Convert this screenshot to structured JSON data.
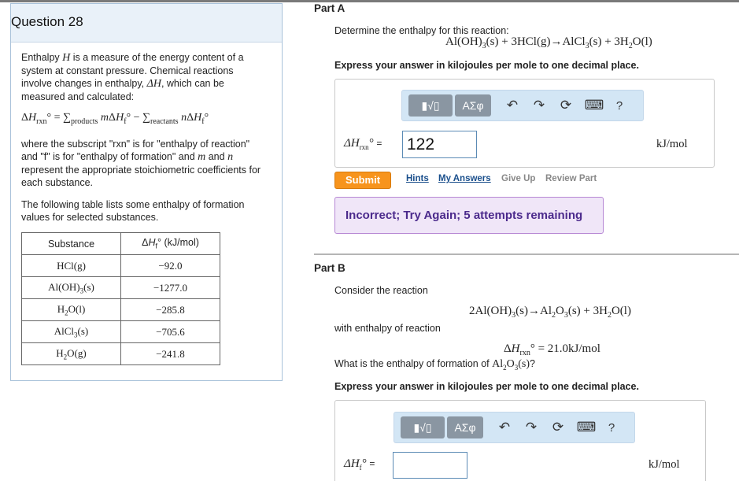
{
  "question": {
    "title": "Question 28",
    "intro_l1_a": "Enthalpy ",
    "intro_H": "H",
    "intro_l1_b": " is a measure of the energy content of a",
    "intro_l2": "system at constant pressure. Chemical reactions",
    "intro_l3_a": "involve changes in enthalpy, ",
    "intro_dH": "ΔH",
    "intro_l3_b": ", which can be",
    "intro_l4": "measured and calculated:",
    "where_l1": "where the subscript \"rxn\" is for \"enthalpy of reaction\"",
    "where_l2_a": "and \"f\" is for \"enthalpy of formation\" and ",
    "where_m": "m",
    "where_and": " and ",
    "where_n": "n",
    "where_l3": "represent the appropriate stoichiometric coefficients for",
    "where_l4": "each substance.",
    "table_intro_l1": "The following table lists some enthalpy of formation",
    "table_intro_l2": "values for selected substances.",
    "table_header_substance": "Substance",
    "table_header_enthalpy": "ΔHf° (kJ/mol)",
    "rows": [
      {
        "substance": "HCl(g)",
        "value": "−92.0"
      },
      {
        "substance": "Al(OH)3(s)",
        "value": "−1277.0"
      },
      {
        "substance": "H2O(l)",
        "value": "−285.8"
      },
      {
        "substance": "AlCl3(s)",
        "value": "−705.6"
      },
      {
        "substance": "H2O(g)",
        "value": "−241.8"
      }
    ]
  },
  "part_a": {
    "title": "Part A",
    "prompt": "Determine the enthalpy for this reaction:",
    "express": "Express your answer in kilojoules per mole to one decimal place.",
    "answer_value": "122",
    "unit": "kJ/mol",
    "submit_label": "Submit",
    "hints_label": "Hints",
    "my_answers_label": "My Answers",
    "give_up_label": "Give Up",
    "review_part_label": "Review Part",
    "feedback": "Incorrect; Try Again; 5 attempts remaining"
  },
  "part_b": {
    "title": "Part B",
    "consider": "Consider the reaction",
    "with_enthalpy": "with enthalpy of reaction",
    "rxn_value": "= 21.0kJ/mol",
    "question_a": "What is the enthalpy of formation of ",
    "question_b": "?",
    "express": "Express your answer in kilojoules per mole to one decimal place.",
    "answer_value": "",
    "unit": "kJ/mol"
  },
  "toolbar": {
    "template_label": "▮√▯",
    "symbols_label": "ΑΣφ",
    "help_label": "?",
    "undo_icon": "↶",
    "redo_icon": "↷",
    "reset_icon": "⟳",
    "keyboard_icon": "⌨"
  }
}
